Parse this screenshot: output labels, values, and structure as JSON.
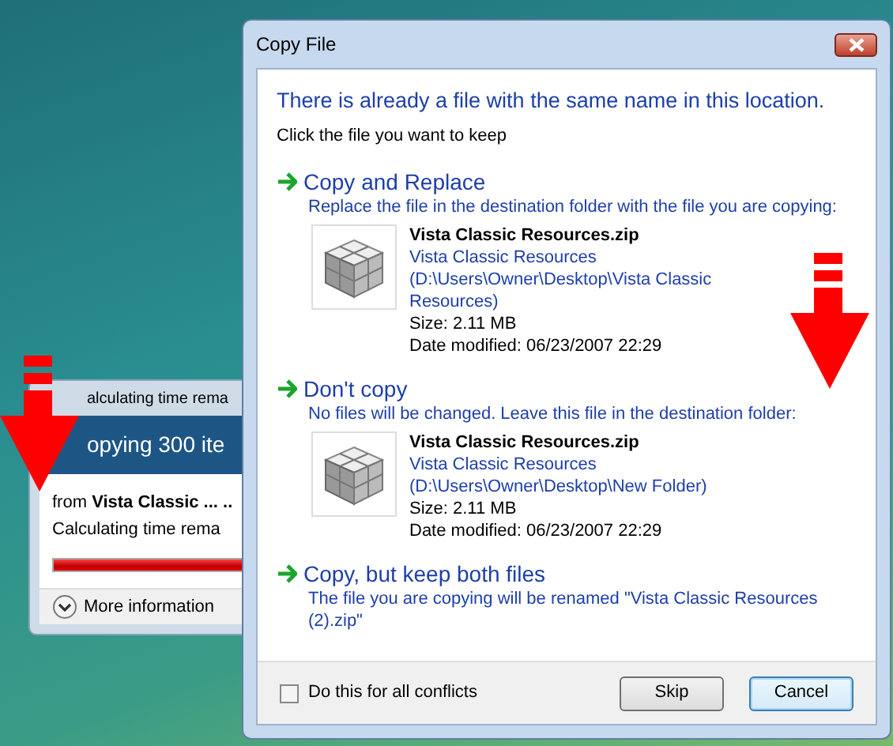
{
  "progress_window": {
    "title": "alculating time rema",
    "heading": "opying 300 ite",
    "from_label": "from",
    "from_name": "Vista Classic ... ..",
    "status": "Calculating time rema",
    "progress": {
      "level": 1
    },
    "more_info": "More information"
  },
  "dialog": {
    "title": "Copy File",
    "heading": "There is already a file with the same name in this location.",
    "instruction": "Click the file you want to keep",
    "options": [
      {
        "title": "Copy and Replace",
        "description": "Replace the file in the destination folder with the file you are copying:",
        "file": {
          "name": "Vista Classic Resources.zip",
          "location": "Vista Classic Resources (D:\\Users\\Owner\\Desktop\\Vista Classic Resources)",
          "size": "Size: 2.11 MB",
          "modified": "Date modified: 06/23/2007 22:29"
        }
      },
      {
        "title": "Don't copy",
        "description": "No files will be changed. Leave this file in the destination folder:",
        "file": {
          "name": "Vista Classic Resources.zip",
          "location": "Vista Classic Resources (D:\\Users\\Owner\\Desktop\\New Folder)",
          "size": "Size: 2.11 MB",
          "modified": "Date modified: 06/23/2007 22:29"
        }
      },
      {
        "title": "Copy, but keep both files",
        "description": "The file you are copying will be renamed \"Vista Classic Resources (2).zip\""
      }
    ],
    "checkbox": {
      "label": "Do this for all conflicts",
      "checked": false
    },
    "buttons": [
      {
        "label": "Skip",
        "default": false
      },
      {
        "label": "Cancel",
        "default": true
      }
    ]
  },
  "annotations": [
    {
      "kind": "arrow"
    },
    {
      "kind": "arrow"
    }
  ]
}
